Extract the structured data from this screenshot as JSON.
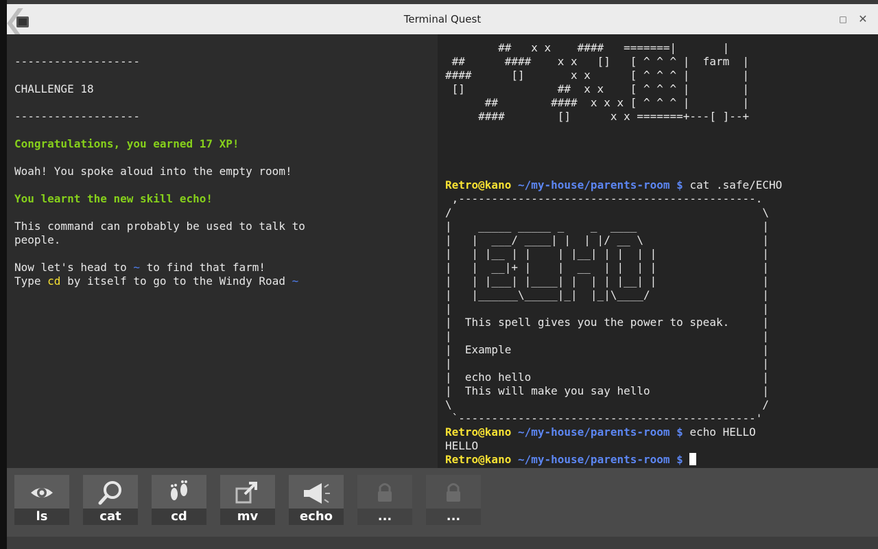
{
  "window": {
    "title": "Terminal Quest"
  },
  "left_lines": [
    {
      "text": "-------------------"
    },
    {
      "text": "CHALLENGE 18"
    },
    {
      "text": "-------------------"
    },
    {
      "text": "Congratulations, you earned 17 XP!"
    },
    {
      "text": "Woah! You spoke aloud into the empty room!"
    },
    {
      "text": "You learnt the new skill echo!"
    },
    {
      "text": "This command can probably be used to talk to"
    },
    {
      "text": "people."
    },
    {
      "text": "Now let's head to ",
      "b": "~",
      "c": " to find that farm!"
    },
    {
      "text": "Type ",
      "b": "cd",
      "c": " by itself to go to the Windy Road ",
      "d": "~"
    }
  ],
  "map_lines": [
    "        ##   x x    ####   =======|       |",
    " ##      ####    x x   []   [ ^ ^ ^ |  farm  |",
    "####      []       x x      [ ^ ^ ^ |        |",
    " []              ##  x x    [ ^ ^ ^ |        |",
    "      ##        ####  x x x [ ^ ^ ^ |        |",
    "     ####        []      x x =======+---[ ]--+"
  ],
  "prompt": {
    "user": "Retro@kano",
    "path": "~/my-house/parents-room",
    "symbol": "$"
  },
  "commands": {
    "cat": "cat .safe/ECHO",
    "echo": "echo HELLO",
    "output": "HELLO"
  },
  "scroll_lines": [
    " ,---------------------------------------------.",
    "/                                               \\",
    "|    _____ _____ _    _  ____                   |",
    "|   |  ___/ ____| |  | |/ __ \\                  |",
    "|   | |__ | |    | |__| | |  | |                |",
    "|   |  __|+ |    |  __  | |  | |                |",
    "|   | |___| |____| |  | | |__| |                |",
    "|   |______\\_____|_|  |_|\\____/                 |",
    "|                                               |",
    "|  This spell gives you the power to speak.     |",
    "|                                               |",
    "|  Example                                      |",
    "|                                               |",
    "|  echo hello                                   |",
    "|  This will make you say hello                 |",
    "\\                                               /",
    " `---------------------------------------------'"
  ],
  "toolbar": {
    "ls": "ls",
    "cat": "cat",
    "cd": "cd",
    "mv": "mv",
    "echo": "echo",
    "locked1": "...",
    "locked2": "..."
  },
  "icons": {
    "ls": "eye-icon",
    "cat": "magnifier-icon",
    "cd": "footprints-icon",
    "mv": "move-arrow-icon",
    "echo": "megaphone-icon",
    "locked": "padlock-icon"
  },
  "colors": {
    "green": "#86d01b",
    "yellow": "#f8e233",
    "blue": "#5c86f2"
  }
}
